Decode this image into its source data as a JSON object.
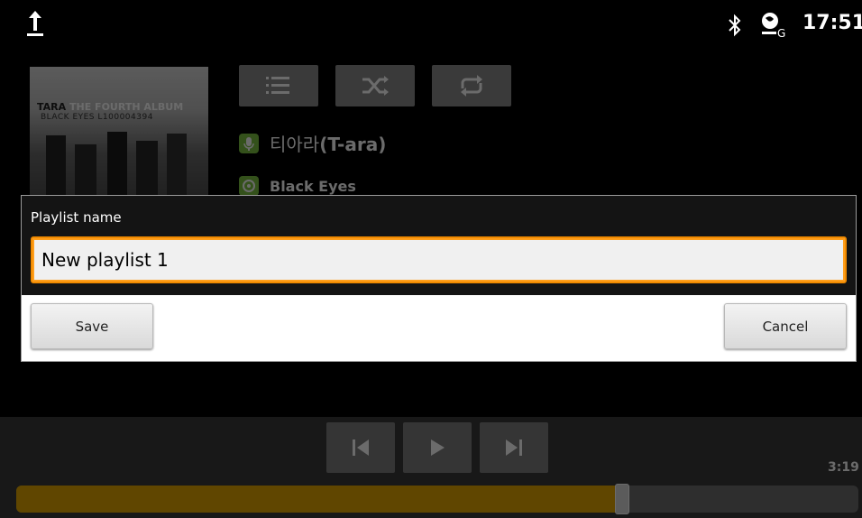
{
  "status_bar": {
    "time": "17:51",
    "icons": [
      "upload-icon",
      "bluetooth-icon",
      "network-icon"
    ]
  },
  "player": {
    "album_art": {
      "title_part1": "TARA",
      "title_part2": "THE FOURTH",
      "title_part3": "ALBUM",
      "subtitle": "BLACK EYES L100004394"
    },
    "controls": [
      "playlist-icon",
      "shuffle-icon",
      "repeat-icon"
    ],
    "artist_prefix": "티아라",
    "artist_suffix": "(T-ara)",
    "song": "Black Eyes",
    "transport": [
      "previous-icon",
      "play-icon",
      "next-icon"
    ],
    "total_time": "3:19",
    "progress": 0.72
  },
  "dialog": {
    "label": "Playlist name",
    "input_value": "New playlist 1",
    "save_label": "Save",
    "cancel_label": "Cancel"
  },
  "colors": {
    "accent": "#f08a00",
    "progress": "#e5a800",
    "music_green": "#7cc242"
  }
}
